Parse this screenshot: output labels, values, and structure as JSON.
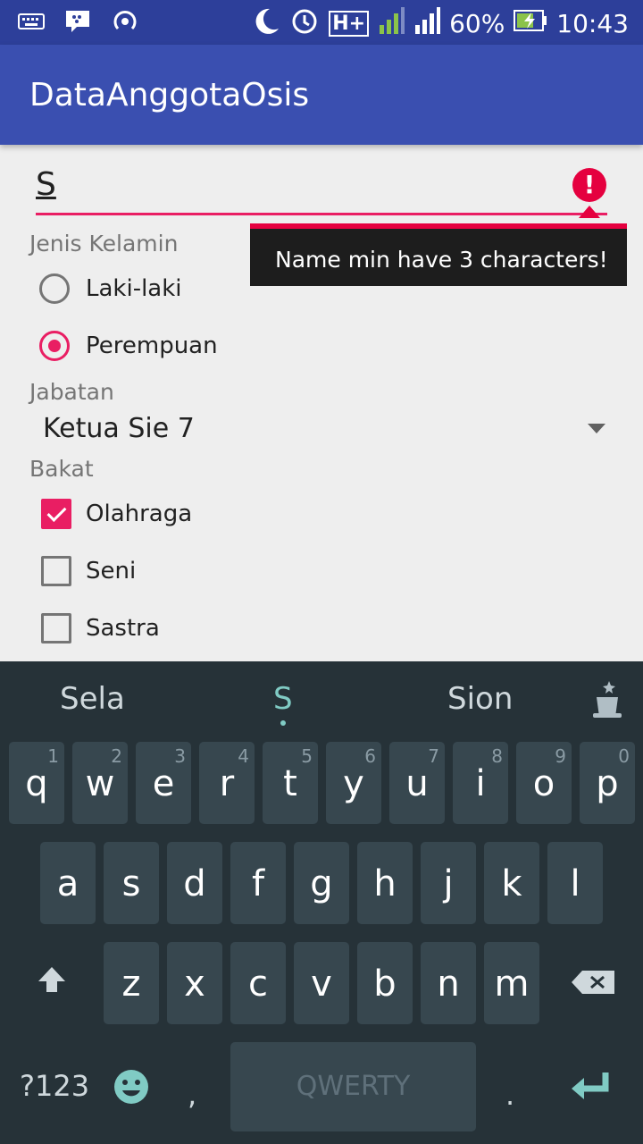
{
  "status": {
    "battery": "60%",
    "time": "10:43",
    "network": "H+"
  },
  "app": {
    "title": "DataAnggotaOsis"
  },
  "form": {
    "name_value": "S",
    "error_message": "Name min have 3 characters!",
    "gender": {
      "label": "Jenis Kelamin",
      "options": [
        "Laki-laki",
        "Perempuan"
      ],
      "selected": "Perempuan"
    },
    "position": {
      "label": "Jabatan",
      "value": "Ketua Sie 7"
    },
    "talent": {
      "label": "Bakat",
      "options": [
        {
          "label": "Olahraga",
          "checked": true
        },
        {
          "label": "Seni",
          "checked": false
        },
        {
          "label": "Sastra",
          "checked": false
        }
      ]
    }
  },
  "keyboard": {
    "suggestions": [
      "Sela",
      "S",
      "Sion"
    ],
    "row1": [
      {
        "k": "q",
        "h": "1"
      },
      {
        "k": "w",
        "h": "2"
      },
      {
        "k": "e",
        "h": "3"
      },
      {
        "k": "r",
        "h": "4"
      },
      {
        "k": "t",
        "h": "5"
      },
      {
        "k": "y",
        "h": "6"
      },
      {
        "k": "u",
        "h": "7"
      },
      {
        "k": "i",
        "h": "8"
      },
      {
        "k": "o",
        "h": "9"
      },
      {
        "k": "p",
        "h": "0"
      }
    ],
    "row2": [
      "a",
      "s",
      "d",
      "f",
      "g",
      "h",
      "j",
      "k",
      "l"
    ],
    "row3": [
      "z",
      "x",
      "c",
      "v",
      "b",
      "n",
      "m"
    ],
    "symbols_label": "?123",
    "comma": ",",
    "space_label": "QWERTY",
    "period": "."
  },
  "colors": {
    "accent": "#e91e63",
    "appbar": "#3a4fb0",
    "error": "#e5003f"
  }
}
